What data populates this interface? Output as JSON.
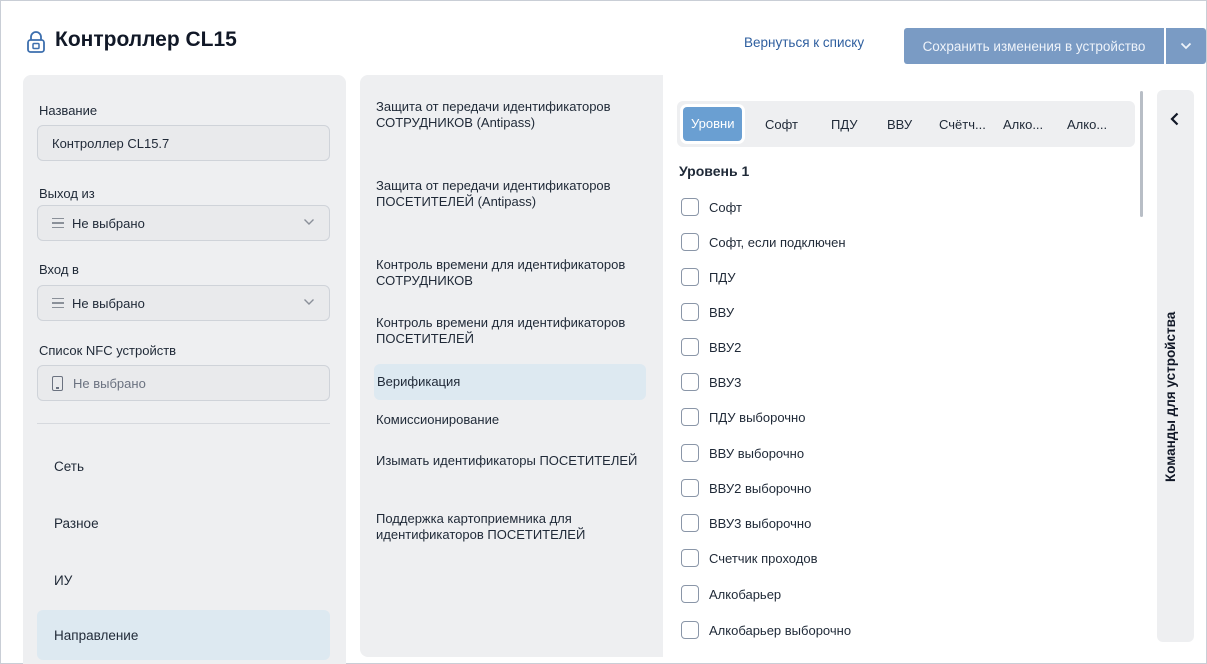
{
  "header": {
    "title": "Контроллер CL15",
    "back_link": "Вернуться к списку",
    "save_button": "Сохранить изменения в устройство"
  },
  "left": {
    "name_label": "Название",
    "name_value": "Контроллер CL15.7",
    "exit_label": "Выход из",
    "exit_value": "Не выбрано",
    "entry_label": "Вход в",
    "entry_value": "Не выбрано",
    "nfc_label": "Список NFC устройств",
    "nfc_value": "Не выбрано",
    "sections": [
      "Сеть",
      "Разное",
      "ИУ",
      "Направление"
    ]
  },
  "middle": {
    "items": [
      "Защита от передачи идентификаторов СОТРУДНИКОВ (Antipass)",
      "Защита от передачи идентификаторов ПОСЕТИТЕЛЕЙ (Antipass)",
      "Контроль времени для идентификаторов СОТРУДНИКОВ",
      "Контроль времени для идентификаторов ПОСЕТИТЕЛЕЙ",
      "Верификация",
      "Комиссионирование",
      "Изымать идентификаторы ПОСЕТИТЕЛЕЙ",
      "Поддержка картоприемника для идентификаторов ПОСЕТИТЕЛЕЙ"
    ],
    "active_index": 4
  },
  "content": {
    "tabs": [
      "Уровни",
      "Софт",
      "ПДУ",
      "ВВУ",
      "Счётч...",
      "Алко...",
      "Алко..."
    ],
    "active_tab": 0,
    "level_title": "Уровень 1",
    "checkboxes": [
      "Софт",
      "Софт, если подключен",
      "ПДУ",
      "ВВУ",
      "ВВУ2",
      "ВВУ3",
      "ПДУ выборочно",
      "ВВУ выборочно",
      "ВВУ2 выборочно",
      "ВВУ3 выборочно",
      "Счетчик проходов",
      "Алкобарьер",
      "Алкобарьер выборочно"
    ]
  },
  "commands_panel": {
    "label": "Команды для устройства"
  },
  "colors": {
    "accent": "#6a9fd2",
    "save_button": "#7a9bc4",
    "active_item": "#dde9f1",
    "panel_bg": "#eeeff1"
  }
}
